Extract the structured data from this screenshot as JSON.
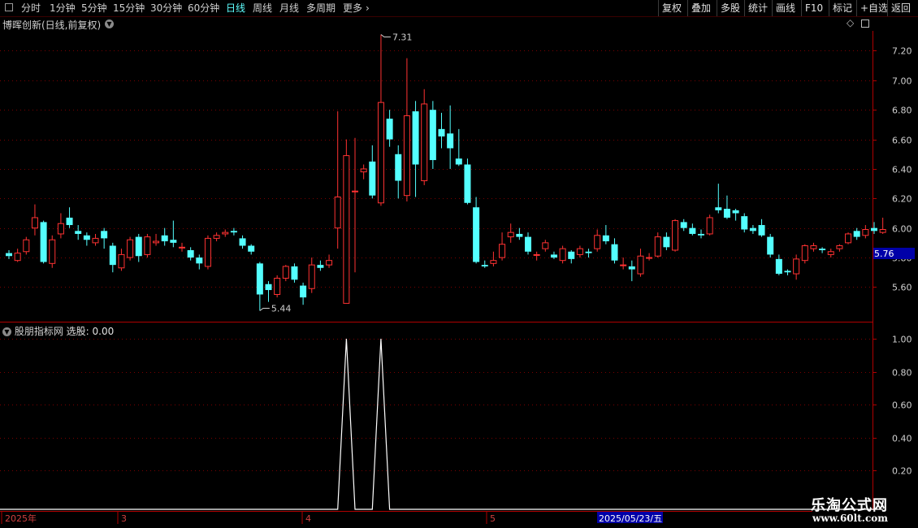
{
  "toolbar": {
    "periods": [
      "分时",
      "1分钟",
      "5分钟",
      "15分钟",
      "30分钟",
      "60分钟",
      "日线",
      "周线",
      "月线",
      "多周期",
      "更多"
    ],
    "active_period": "日线",
    "right_buttons": [
      "复权",
      "叠加",
      "多股",
      "统计",
      "画线",
      "F10",
      "标记",
      "+自选",
      "返回"
    ]
  },
  "main_panel": {
    "title": "博晖创新(日线,前复权)",
    "high_marker": "7.31",
    "low_marker": "5.44",
    "current_price": "5.76"
  },
  "indicator_panel": {
    "title": "股朋指标网",
    "value_label": "选股: 0.00"
  },
  "time_axis": {
    "labels": [
      "2025年",
      "3",
      "4",
      "5"
    ],
    "cursor_date": "2025/05/23/五"
  },
  "watermark": {
    "line1": "乐淘公式网",
    "line2": "www.60lt.com"
  },
  "colors": {
    "up": "#ff3232",
    "down": "#54ffff",
    "axis": "#b00000",
    "background": "#000000",
    "signal": "#ffffff"
  },
  "chart_data": [
    {
      "type": "candlestick",
      "title": "博晖创新(日线,前复权)",
      "y_ticks": [
        5.6,
        5.8,
        6.0,
        6.2,
        6.4,
        6.6,
        6.8,
        7.0,
        7.2
      ],
      "ylim": [
        5.38,
        7.38
      ],
      "x_labels": [
        "2025年",
        "3",
        "4",
        "5"
      ],
      "candles": [
        [
          5.83,
          5.81,
          5.85,
          5.79
        ],
        [
          5.78,
          5.83,
          5.86,
          5.77
        ],
        [
          5.84,
          5.92,
          5.94,
          5.82
        ],
        [
          6.0,
          6.07,
          6.16,
          5.95
        ],
        [
          6.04,
          5.77,
          6.05,
          5.76
        ],
        [
          5.76,
          5.92,
          5.95,
          5.73
        ],
        [
          5.96,
          6.03,
          6.1,
          5.93
        ],
        [
          6.07,
          6.02,
          6.14,
          6.0
        ],
        [
          5.98,
          5.96,
          6.02,
          5.92
        ],
        [
          5.95,
          5.92,
          5.97,
          5.88
        ],
        [
          5.9,
          5.93,
          5.96,
          5.88
        ],
        [
          5.98,
          5.93,
          6.0,
          5.86
        ],
        [
          5.88,
          5.75,
          5.9,
          5.7
        ],
        [
          5.73,
          5.82,
          5.86,
          5.71
        ],
        [
          5.8,
          5.92,
          5.94,
          5.78
        ],
        [
          5.94,
          5.81,
          5.96,
          5.77
        ],
        [
          5.82,
          5.94,
          5.96,
          5.8
        ],
        [
          5.9,
          5.91,
          5.96,
          5.88
        ],
        [
          5.95,
          5.91,
          6.0,
          5.88
        ],
        [
          5.92,
          5.9,
          6.05,
          5.87
        ],
        [
          5.87,
          5.87,
          5.9,
          5.84
        ],
        [
          5.85,
          5.8,
          5.87,
          5.78
        ],
        [
          5.8,
          5.76,
          5.82,
          5.72
        ],
        [
          5.74,
          5.93,
          5.95,
          5.72
        ],
        [
          5.93,
          5.95,
          5.97,
          5.91
        ],
        [
          5.96,
          5.97,
          5.99,
          5.94
        ],
        [
          5.98,
          5.97,
          6.0,
          5.95
        ],
        [
          5.93,
          5.88,
          5.95,
          5.86
        ],
        [
          5.88,
          5.84,
          5.89,
          5.82
        ],
        [
          5.76,
          5.55,
          5.77,
          5.44
        ],
        [
          5.62,
          5.58,
          5.64,
          5.5
        ],
        [
          5.55,
          5.66,
          5.68,
          5.53
        ],
        [
          5.66,
          5.74,
          5.75,
          5.64
        ],
        [
          5.74,
          5.65,
          5.76,
          5.63
        ],
        [
          5.61,
          5.53,
          5.63,
          5.48
        ],
        [
          5.59,
          5.75,
          5.8,
          5.56
        ],
        [
          5.75,
          5.73,
          5.78,
          5.71
        ],
        [
          5.75,
          5.78,
          5.82,
          5.73
        ],
        [
          6.0,
          6.21,
          6.79,
          5.86
        ],
        [
          5.49,
          6.49,
          6.6,
          5.49
        ],
        [
          6.25,
          6.25,
          6.61,
          5.7
        ],
        [
          6.38,
          6.4,
          6.43,
          6.33
        ],
        [
          6.45,
          6.22,
          6.56,
          6.2
        ],
        [
          6.17,
          6.85,
          7.31,
          6.15
        ],
        [
          6.74,
          6.6,
          6.8,
          6.55
        ],
        [
          6.5,
          6.32,
          6.56,
          6.2
        ],
        [
          6.22,
          6.76,
          7.15,
          6.18
        ],
        [
          6.79,
          6.43,
          6.86,
          6.21
        ],
        [
          6.32,
          6.84,
          6.94,
          6.29
        ],
        [
          6.8,
          6.46,
          6.86,
          6.4
        ],
        [
          6.67,
          6.62,
          6.78,
          6.54
        ],
        [
          6.64,
          6.54,
          6.83,
          6.4
        ],
        [
          6.47,
          6.43,
          6.67,
          6.42
        ],
        [
          6.43,
          6.17,
          6.47,
          6.16
        ],
        [
          6.14,
          5.77,
          6.21,
          5.76
        ],
        [
          5.75,
          5.74,
          5.78,
          5.73
        ],
        [
          5.76,
          5.78,
          5.84,
          5.74
        ],
        [
          5.8,
          5.89,
          5.97,
          5.78
        ],
        [
          5.94,
          5.97,
          6.03,
          5.9
        ],
        [
          5.96,
          5.94,
          6.0,
          5.92
        ],
        [
          5.94,
          5.84,
          5.97,
          5.82
        ],
        [
          5.82,
          5.82,
          5.84,
          5.78
        ],
        [
          5.86,
          5.9,
          5.92,
          5.84
        ],
        [
          5.82,
          5.8,
          5.84,
          5.79
        ],
        [
          5.78,
          5.86,
          5.88,
          5.76
        ],
        [
          5.84,
          5.79,
          5.85,
          5.76
        ],
        [
          5.82,
          5.86,
          5.88,
          5.8
        ],
        [
          5.84,
          5.83,
          5.86,
          5.8
        ],
        [
          5.86,
          5.95,
          5.99,
          5.84
        ],
        [
          5.95,
          5.91,
          6.02,
          5.89
        ],
        [
          5.89,
          5.78,
          5.93,
          5.76
        ],
        [
          5.75,
          5.75,
          5.8,
          5.72
        ],
        [
          5.74,
          5.72,
          5.78,
          5.64
        ],
        [
          5.69,
          5.81,
          5.86,
          5.67
        ],
        [
          5.8,
          5.8,
          5.83,
          5.78
        ],
        [
          5.81,
          5.94,
          5.97,
          5.8
        ],
        [
          5.94,
          5.87,
          5.97,
          5.85
        ],
        [
          5.85,
          6.05,
          6.06,
          5.84
        ],
        [
          6.04,
          6.0,
          6.06,
          5.98
        ],
        [
          6.0,
          5.96,
          6.03,
          5.95
        ],
        [
          5.96,
          5.95,
          5.99,
          5.93
        ],
        [
          5.96,
          6.07,
          6.09,
          5.95
        ],
        [
          6.14,
          6.12,
          6.3,
          6.1
        ],
        [
          6.13,
          6.07,
          6.22,
          6.06
        ],
        [
          6.12,
          6.1,
          6.13,
          6.05
        ],
        [
          6.08,
          5.99,
          6.1,
          5.97
        ],
        [
          6.0,
          5.98,
          6.02,
          5.96
        ],
        [
          6.02,
          5.95,
          6.06,
          5.94
        ],
        [
          5.94,
          5.82,
          5.96,
          5.8
        ],
        [
          5.79,
          5.69,
          5.82,
          5.68
        ],
        [
          5.71,
          5.7,
          5.72,
          5.68
        ],
        [
          5.69,
          5.79,
          5.82,
          5.65
        ],
        [
          5.78,
          5.88,
          5.89,
          5.76
        ],
        [
          5.86,
          5.88,
          5.9,
          5.84
        ],
        [
          5.86,
          5.85,
          5.87,
          5.83
        ],
        [
          5.82,
          5.84,
          5.86,
          5.8
        ],
        [
          5.86,
          5.88,
          5.89,
          5.84
        ],
        [
          5.9,
          5.96,
          5.97,
          5.89
        ],
        [
          5.98,
          5.94,
          6.0,
          5.92
        ],
        [
          5.95,
          5.99,
          6.02,
          5.93
        ],
        [
          6.0,
          5.98,
          6.04,
          5.96
        ],
        [
          5.97,
          5.99,
          6.07,
          5.96
        ]
      ]
    },
    {
      "type": "line",
      "title": "股朋指标网",
      "name": "选股",
      "y_ticks": [
        0.2,
        0.4,
        0.6,
        0.8,
        1.0
      ],
      "ylim": [
        -0.5,
        1.05
      ],
      "signals_at_index": [
        39,
        43
      ],
      "values_rule": "0 everywhere except 1 at signal indices"
    }
  ]
}
